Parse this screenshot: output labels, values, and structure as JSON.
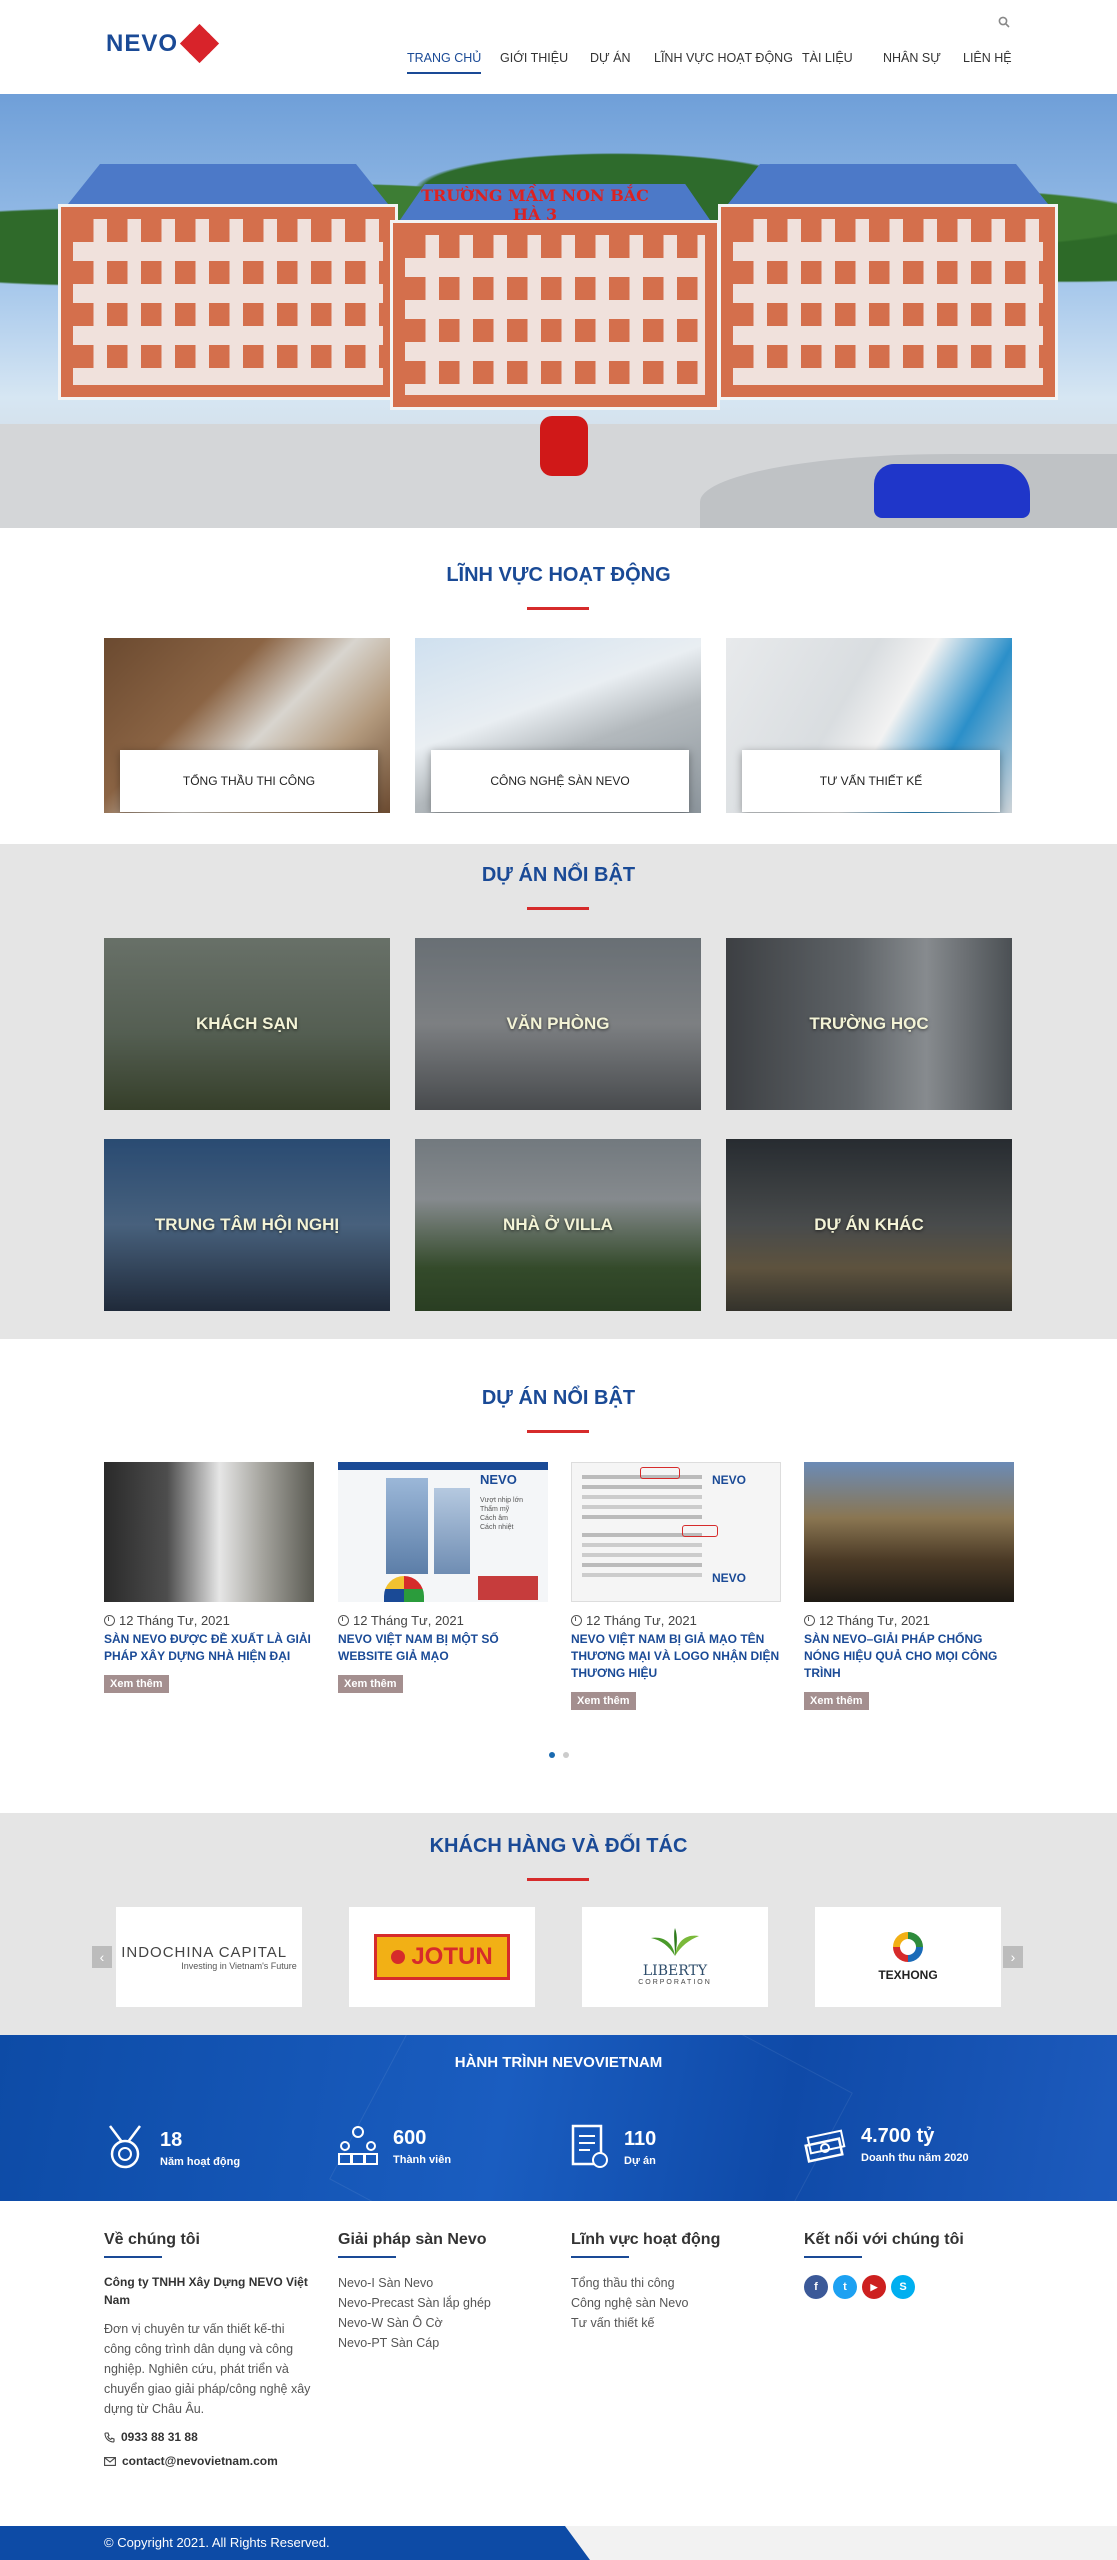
{
  "header": {
    "logo_text": "NEVO",
    "nav": [
      {
        "label": "TRANG CHỦ",
        "active": true
      },
      {
        "label": "GIỚI THIỆU"
      },
      {
        "label": "DỰ ÁN"
      },
      {
        "label": "LĨNH VỰC HOẠT ĐỘNG"
      },
      {
        "label": "TÀI LIỆU"
      },
      {
        "label": "NHÂN SỰ"
      },
      {
        "label": "LIÊN HỆ"
      }
    ]
  },
  "hero": {
    "sign_text": "TRƯỜNG MẦM NON BẮC HÀ 3",
    "slides": 2,
    "active_slide": 1
  },
  "fields": {
    "title": "LĨNH VỰC HOẠT ĐỘNG",
    "items": [
      {
        "label": "TỔNG THẦU THI CÔNG"
      },
      {
        "label": "CÔNG NGHỆ SÀN NEVO"
      },
      {
        "label": "TƯ VẤN THIẾT KẾ"
      }
    ]
  },
  "categories": {
    "title": "DỰ ÁN NỔI BẬT",
    "items": [
      {
        "label": "KHÁCH SẠN"
      },
      {
        "label": "VĂN PHÒNG"
      },
      {
        "label": "TRƯỜNG HỌC"
      },
      {
        "label": "TRUNG TÂM HỘI NGHỊ"
      },
      {
        "label": "NHÀ Ở VILLA"
      },
      {
        "label": "DỰ ÁN KHÁC"
      }
    ]
  },
  "news": {
    "title": "DỰ ÁN NỔI BẬT",
    "read_more": "Xem thêm",
    "items": [
      {
        "date": "12 Tháng Tư, 2021",
        "title": "SÀN NEVO ĐƯỢC ĐỀ XUẤT LÀ GIẢI PHÁP XÂY DỰNG NHÀ HIỆN ĐẠI"
      },
      {
        "date": "12 Tháng Tư, 2021",
        "title": "NEVO VIỆT NAM BỊ MỘT SỐ WEBSITE GIẢ MẠO"
      },
      {
        "date": "12 Tháng Tư, 2021",
        "title": "NEVO VIỆT NAM BỊ GIẢ MẠO TÊN THƯƠNG MẠI VÀ LOGO NHẬN DIỆN THƯƠNG HIỆU"
      },
      {
        "date": "12 Tháng Tư, 2021",
        "title": "SÀN NEVO–GIẢI PHÁP CHỐNG NÓNG HIỆU QUẢ CHO MỌI CÔNG TRÌNH"
      }
    ],
    "news2_side_list": [
      "Vượt nhịp lớn",
      "Thẩm mỹ",
      "Cách âm",
      "Cách nhiệt"
    ]
  },
  "partners": {
    "title": "KHÁCH HÀNG VÀ ĐỐI TÁC",
    "items": [
      {
        "name": "INDOCHINA CAPITAL",
        "sub": "Investing in Vietnam's Future"
      },
      {
        "name": "JOTUN"
      },
      {
        "name": "LIBERTY",
        "sub": "CORPORATION"
      },
      {
        "name": "TEXHONG"
      }
    ],
    "prev_arrow": "‹",
    "next_arrow": "›"
  },
  "stats": {
    "title": "HÀNH TRÌNH NEVOVIETNAM",
    "items": [
      {
        "value": "18",
        "label": "Năm hoạt động",
        "icon": "medal-icon"
      },
      {
        "value": "600",
        "label": "Thành viên",
        "icon": "team-icon"
      },
      {
        "value": "110",
        "label": "Dự án",
        "icon": "certificate-icon"
      },
      {
        "value": "4.700 tỷ",
        "label": "Doanh thu năm 2020",
        "icon": "money-icon"
      }
    ]
  },
  "footer": {
    "about": {
      "title": "Về chúng tôi",
      "company": "Công ty TNHH Xây Dựng NEVO Việt Nam",
      "desc": "Đơn vị chuyên tư vấn thiết kế-thi công công trình dân dụng và công nghiệp. Nghiên cứu, phát triển và chuyển giao giải pháp/công nghệ xây dựng từ Châu Âu.",
      "phone": "0933 88 31 88",
      "email": "contact@nevovietnam.com"
    },
    "solutions": {
      "title": "Giải pháp sàn Nevo",
      "links": [
        "Nevo-I Sàn Nevo",
        "Nevo-Precast Sàn lắp ghép",
        "Nevo-W Sàn Ô Cờ",
        "Nevo-PT Sàn Cáp"
      ]
    },
    "fields": {
      "title": "Lĩnh vực hoạt động",
      "links": [
        "Tổng thầu thi công",
        "Công nghệ sàn Nevo",
        "Tư vấn thiết kế"
      ]
    },
    "connect": {
      "title": "Kết nối với chúng tôi",
      "social": [
        {
          "name": "facebook",
          "glyph": "f",
          "color": "#3b5998"
        },
        {
          "name": "twitter",
          "glyph": "t",
          "color": "#1da1f2"
        },
        {
          "name": "youtube",
          "glyph": "▶",
          "color": "#cd201f"
        },
        {
          "name": "skype",
          "glyph": "S",
          "color": "#00aff0"
        }
      ]
    },
    "copyright": "© Copyright 2021. All Rights Reserved."
  }
}
